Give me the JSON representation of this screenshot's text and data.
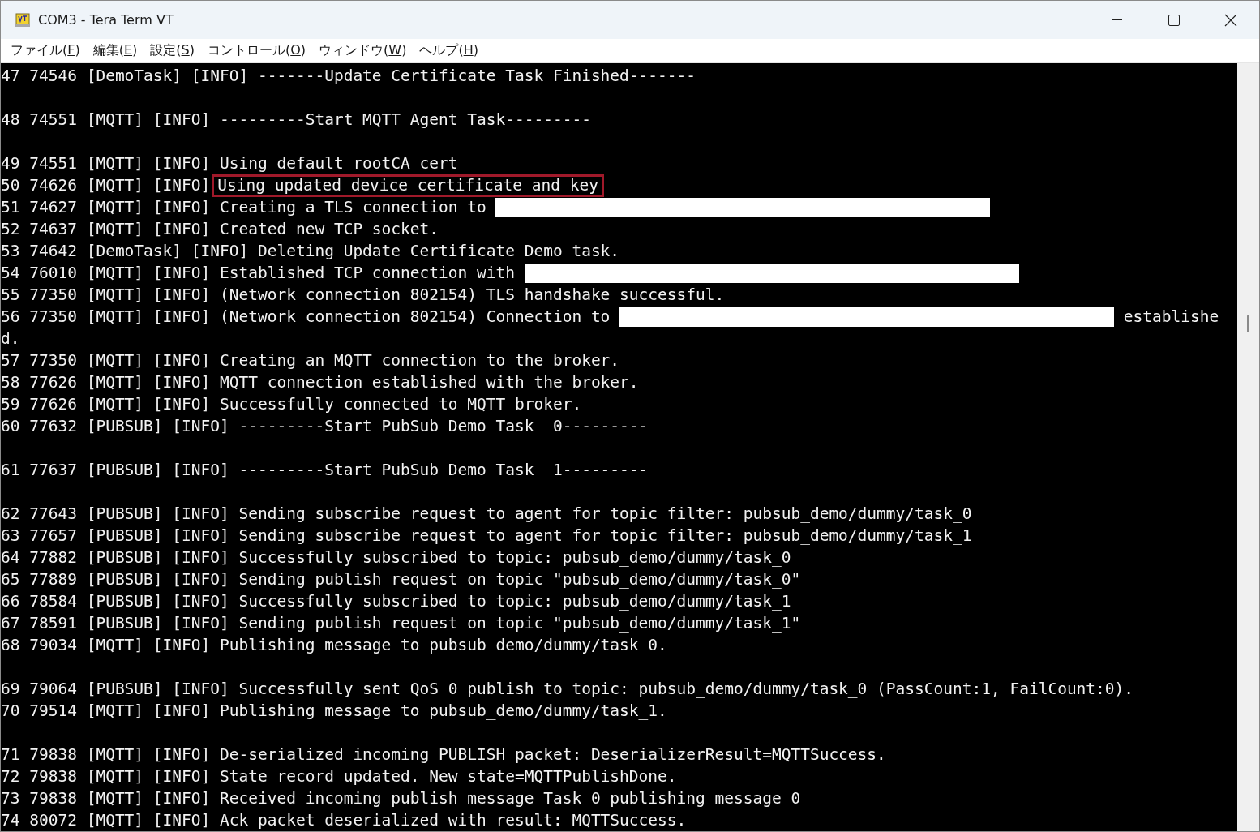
{
  "window": {
    "title": "COM3 - Tera Term VT"
  },
  "menu": [
    {
      "label": "ファイル(F)"
    },
    {
      "label": "編集(E)"
    },
    {
      "label": "設定(S)"
    },
    {
      "label": "コントロール(O)"
    },
    {
      "label": "ウィンドウ(W)"
    },
    {
      "label": "ヘルプ(H)"
    }
  ],
  "terminal": {
    "lines": [
      {
        "kind": "text",
        "segments": [
          {
            "kind": "text",
            "text": "47 74546 [DemoTask] [INFO] -------Update Certificate Task Finished-------"
          }
        ]
      },
      {
        "kind": "blank"
      },
      {
        "kind": "text",
        "segments": [
          {
            "kind": "text",
            "text": "48 74551 [MQTT] [INFO] ---------Start MQTT Agent Task---------"
          }
        ]
      },
      {
        "kind": "blank"
      },
      {
        "kind": "text",
        "segments": [
          {
            "kind": "text",
            "text": "49 74551 [MQTT] [INFO] Using default rootCA cert"
          }
        ]
      },
      {
        "kind": "text",
        "segments": [
          {
            "kind": "text",
            "text": "50 74626 [MQTT] [INFO]"
          },
          {
            "kind": "highlight",
            "text": "Using updated device certificate and key"
          }
        ]
      },
      {
        "kind": "text",
        "segments": [
          {
            "kind": "text",
            "text": "51 74627 [MQTT] [INFO] Creating a TLS connection to "
          },
          {
            "kind": "redaction"
          }
        ]
      },
      {
        "kind": "text",
        "segments": [
          {
            "kind": "text",
            "text": "52 74637 [MQTT] [INFO] Created new TCP socket."
          }
        ]
      },
      {
        "kind": "text",
        "segments": [
          {
            "kind": "text",
            "text": "53 74642 [DemoTask] [INFO] Deleting Update Certificate Demo task."
          }
        ]
      },
      {
        "kind": "text",
        "segments": [
          {
            "kind": "text",
            "text": "54 76010 [MQTT] [INFO] Established TCP connection with "
          },
          {
            "kind": "redaction"
          }
        ]
      },
      {
        "kind": "text",
        "segments": [
          {
            "kind": "text",
            "text": "55 77350 [MQTT] [INFO] (Network connection 802154) TLS handshake successful."
          }
        ]
      },
      {
        "kind": "text",
        "segments": [
          {
            "kind": "text",
            "text": "56 77350 [MQTT] [INFO] (Network connection 802154) Connection to "
          },
          {
            "kind": "redaction"
          },
          {
            "kind": "text",
            "text": " establishe"
          }
        ]
      },
      {
        "kind": "text",
        "segments": [
          {
            "kind": "text",
            "text": "d."
          }
        ]
      },
      {
        "kind": "text",
        "segments": [
          {
            "kind": "text",
            "text": "57 77350 [MQTT] [INFO] Creating an MQTT connection to the broker."
          }
        ]
      },
      {
        "kind": "text",
        "segments": [
          {
            "kind": "text",
            "text": "58 77626 [MQTT] [INFO] MQTT connection established with the broker."
          }
        ]
      },
      {
        "kind": "text",
        "segments": [
          {
            "kind": "text",
            "text": "59 77626 [MQTT] [INFO] Successfully connected to MQTT broker."
          }
        ]
      },
      {
        "kind": "text",
        "segments": [
          {
            "kind": "text",
            "text": "60 77632 [PUBSUB] [INFO] ---------Start PubSub Demo Task  0---------"
          }
        ]
      },
      {
        "kind": "blank"
      },
      {
        "kind": "text",
        "segments": [
          {
            "kind": "text",
            "text": "61 77637 [PUBSUB] [INFO] ---------Start PubSub Demo Task  1---------"
          }
        ]
      },
      {
        "kind": "blank"
      },
      {
        "kind": "text",
        "segments": [
          {
            "kind": "text",
            "text": "62 77643 [PUBSUB] [INFO] Sending subscribe request to agent for topic filter: pubsub_demo/dummy/task_0"
          }
        ]
      },
      {
        "kind": "text",
        "segments": [
          {
            "kind": "text",
            "text": "63 77657 [PUBSUB] [INFO] Sending subscribe request to agent for topic filter: pubsub_demo/dummy/task_1"
          }
        ]
      },
      {
        "kind": "text",
        "segments": [
          {
            "kind": "text",
            "text": "64 77882 [PUBSUB] [INFO] Successfully subscribed to topic: pubsub_demo/dummy/task_0"
          }
        ]
      },
      {
        "kind": "text",
        "segments": [
          {
            "kind": "text",
            "text": "65 77889 [PUBSUB] [INFO] Sending publish request on topic \"pubsub_demo/dummy/task_0\""
          }
        ]
      },
      {
        "kind": "text",
        "segments": [
          {
            "kind": "text",
            "text": "66 78584 [PUBSUB] [INFO] Successfully subscribed to topic: pubsub_demo/dummy/task_1"
          }
        ]
      },
      {
        "kind": "text",
        "segments": [
          {
            "kind": "text",
            "text": "67 78591 [PUBSUB] [INFO] Sending publish request on topic \"pubsub_demo/dummy/task_1\""
          }
        ]
      },
      {
        "kind": "text",
        "segments": [
          {
            "kind": "text",
            "text": "68 79034 [MQTT] [INFO] Publishing message to pubsub_demo/dummy/task_0."
          }
        ]
      },
      {
        "kind": "blank"
      },
      {
        "kind": "text",
        "segments": [
          {
            "kind": "text",
            "text": "69 79064 [PUBSUB] [INFO] Successfully sent QoS 0 publish to topic: pubsub_demo/dummy/task_0 (PassCount:1, FailCount:0)."
          }
        ]
      },
      {
        "kind": "text",
        "segments": [
          {
            "kind": "text",
            "text": "70 79514 [MQTT] [INFO] Publishing message to pubsub_demo/dummy/task_1."
          }
        ]
      },
      {
        "kind": "blank"
      },
      {
        "kind": "text",
        "segments": [
          {
            "kind": "text",
            "text": "71 79838 [MQTT] [INFO] De-serialized incoming PUBLISH packet: DeserializerResult=MQTTSuccess."
          }
        ]
      },
      {
        "kind": "text",
        "segments": [
          {
            "kind": "text",
            "text": "72 79838 [MQTT] [INFO] State record updated. New state=MQTTPublishDone."
          }
        ]
      },
      {
        "kind": "text",
        "segments": [
          {
            "kind": "text",
            "text": "73 79838 [MQTT] [INFO] Received incoming publish message Task 0 publishing message 0"
          }
        ]
      },
      {
        "kind": "text",
        "segments": [
          {
            "kind": "text",
            "text": "74 80072 [MQTT] [INFO] Ack packet deserialized with result: MQTTSuccess."
          }
        ]
      }
    ]
  }
}
